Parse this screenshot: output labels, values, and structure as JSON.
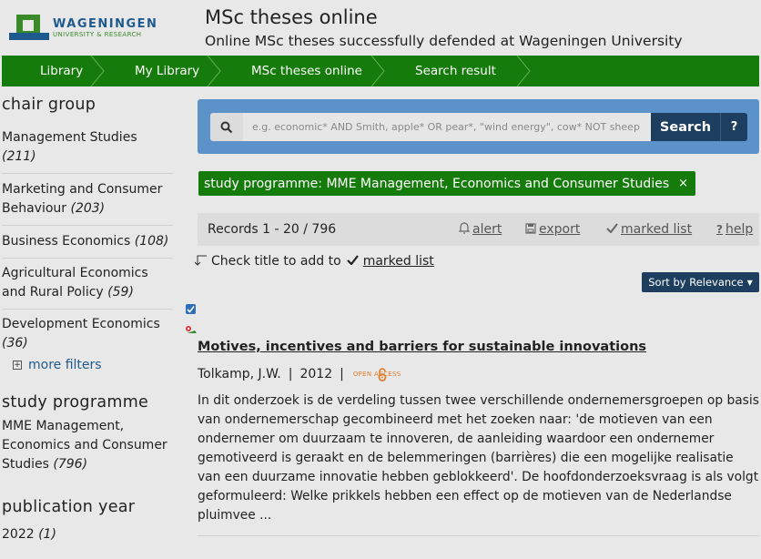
{
  "logo": {
    "line1": "WAGENINGEN",
    "line2": "UNIVERSITY & RESEARCH"
  },
  "site": {
    "title": "MSc theses online",
    "subtitle": "Online MSc theses successfully defended at Wageningen University"
  },
  "breadcrumbs": [
    "Library",
    "My Library",
    "MSc theses online",
    "Search result"
  ],
  "sidebar": {
    "chair_group": {
      "title": "chair group",
      "items": [
        {
          "label": "Management Studies",
          "count": "(211)"
        },
        {
          "label": "Marketing and Consumer Behaviour",
          "count": "(203)"
        },
        {
          "label": "Business Economics",
          "count": "(108)"
        },
        {
          "label": "Agricultural Economics and Rural Policy",
          "count": "(59)"
        },
        {
          "label": "Development Economics",
          "count": "(36)"
        }
      ],
      "more": "more filters"
    },
    "study_programme": {
      "title": "study programme",
      "items": [
        {
          "label": "MME Management, Economics and Consumer Studies",
          "count": "(796)"
        }
      ]
    },
    "publication_year": {
      "title": "publication year",
      "items": [
        {
          "label": "2022",
          "count": "(1)"
        }
      ]
    }
  },
  "search": {
    "placeholder": "e.g. economic* AND Smith, apple* OR pear*, \"wind energy\", cow* NOT sheep",
    "button": "Search",
    "help": "?"
  },
  "filter_tag": {
    "label": "study programme: MME Management, Economics and Consumer Studies",
    "remove": "×"
  },
  "records": {
    "count": "Records 1 - 20 / 796",
    "alert": "alert",
    "export": "export",
    "marked": "marked list",
    "help": "help"
  },
  "check_tip": {
    "text": "Check title to add to",
    "link": "marked list"
  },
  "sort": {
    "label": "Sort by Relevance"
  },
  "result": {
    "checked": true,
    "title": "Motives, incentives and barriers for sustainable innovations",
    "author": "Tolkamp, J.W.",
    "year": "2012",
    "open_access": "OPEN ACCESS",
    "abstract": "In dit onderzoek is de verdeling tussen twee verschillende ondernemersgroepen op basis van ondernemerschap gecombineerd met het zoeken naar: 'de motieven van een ondernemer om duurzaam te innoveren, de aanleiding waardoor een ondernemer gemotiveerd is geraakt en de belemmeringen (barrières) die een mogelijke realisatie van een duurzame innovatie hebben geblokkeerd'. De hoofdonderzoeksvraag is als volgt geformuleerd: Welke prikkels hebben een effect op de motieven van de Nederlandse pluimvee ..."
  },
  "colors": {
    "green": "#157c0b",
    "navy": "#1d3e5e",
    "blue": "#5a92c9",
    "bg": "#e8e8e8"
  }
}
